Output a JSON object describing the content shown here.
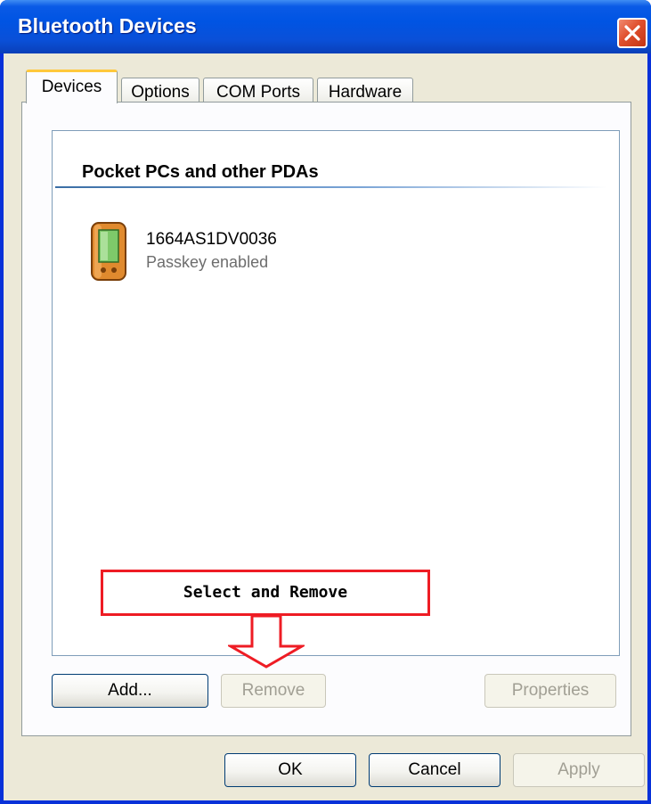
{
  "window": {
    "title": "Bluetooth Devices"
  },
  "tabs": [
    {
      "label": "Devices",
      "selected": true
    },
    {
      "label": "Options",
      "selected": false
    },
    {
      "label": "COM Ports",
      "selected": false
    },
    {
      "label": "Hardware",
      "selected": false
    }
  ],
  "device_list": {
    "group_header": "Pocket PCs and other PDAs",
    "devices": [
      {
        "name": "1664AS1DV0036",
        "status": "Passkey enabled",
        "icon": "pda-icon"
      }
    ]
  },
  "callout": {
    "text": "Select and Remove",
    "color": "#ee1c24"
  },
  "panel_buttons": {
    "add": "Add...",
    "remove": "Remove",
    "properties": "Properties"
  },
  "dialog_buttons": {
    "ok": "OK",
    "cancel": "Cancel",
    "apply": "Apply"
  },
  "colors": {
    "titlebar": "#0054e3",
    "dialog_bg": "#ece9d8",
    "selected_tab_accent": "#ffc83c"
  }
}
